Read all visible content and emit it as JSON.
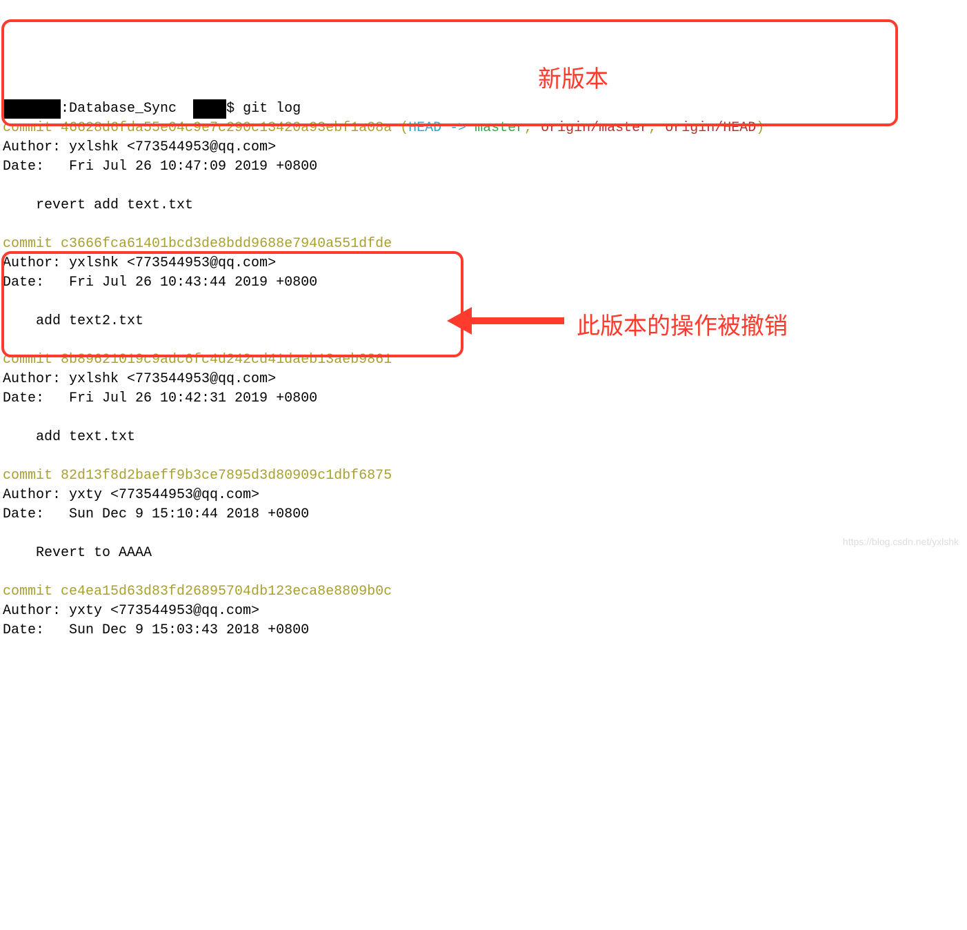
{
  "prompt": {
    "prefix_redacted": "███████",
    "mid1": ":Database_Sync  ",
    "redacted2": "████",
    "mid2": "$ ",
    "command": "git log"
  },
  "commits": [
    {
      "hash_label": "commit ",
      "hash": "46628d6fda55e04c9e7c290c13420a93ebf1a08a",
      "refs": {
        "open": " (",
        "head": "HEAD -> ",
        "local": "master",
        "c1": ", ",
        "remote1": "origin/master",
        "c2": ", ",
        "remote2": "origin/HEAD",
        "close": ")"
      },
      "author_line": "Author: yxlshk <773544953@qq.com>",
      "date_line": "Date:   Fri Jul 26 10:47:09 2019 +0800",
      "message": "    revert add text.txt"
    },
    {
      "hash_label": "commit ",
      "hash": "c3666fca61401bcd3de8bdd9688e7940a551dfde",
      "author_line": "Author: yxlshk <773544953@qq.com>",
      "date_line": "Date:   Fri Jul 26 10:43:44 2019 +0800",
      "message": "    add text2.txt"
    },
    {
      "hash_label": "commit ",
      "hash": "8b89621019c9adc6fc4d242cd41daeb13aeb9861",
      "author_line": "Author: yxlshk <773544953@qq.com>",
      "date_line": "Date:   Fri Jul 26 10:42:31 2019 +0800",
      "message": "    add text.txt"
    },
    {
      "hash_label": "commit ",
      "hash": "82d13f8d2baeff9b3ce7895d3d80909c1dbf6875",
      "author_line": "Author: yxty <773544953@qq.com>",
      "date_line": "Date:   Sun Dec 9 15:10:44 2018 +0800",
      "message": "    Revert to AAAA"
    },
    {
      "hash_label": "commit ",
      "hash": "ce4ea15d63d83fd26895704db123eca8e8809b0c",
      "author_line": "Author: yxty <773544953@qq.com>",
      "date_line": "Date:   Sun Dec 9 15:03:43 2018 +0800",
      "message": ""
    }
  ],
  "annotations": {
    "new_version": "新版本",
    "reverted": "此版本的操作被撤销"
  },
  "watermark": "https://blog.csdn.net/yxlshk"
}
